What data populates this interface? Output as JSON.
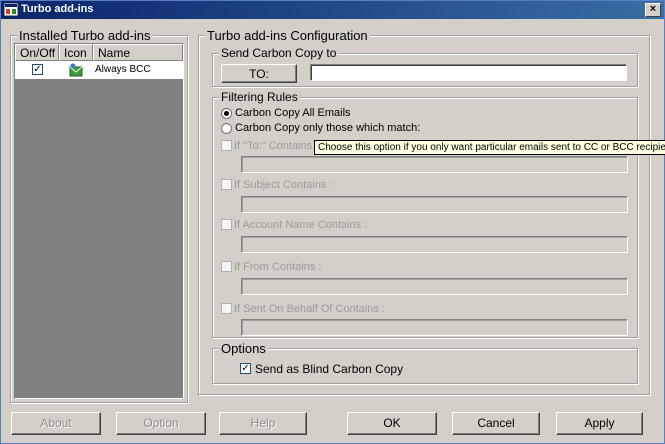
{
  "window": {
    "title": "Turbo add-ins",
    "close_symbol": "×"
  },
  "installed": {
    "group_title": "Installed Turbo add-ins",
    "columns": [
      "On/Off",
      "Icon",
      "Name"
    ],
    "rows": [
      {
        "enabled": "✓",
        "name": "Always BCC"
      }
    ]
  },
  "config": {
    "group_title": "Turbo add-ins Configuration",
    "send_cc": {
      "title": "Send Carbon Copy to",
      "to_button": "TO:",
      "to_value": ""
    },
    "filtering": {
      "title": "Filtering Rules",
      "radio_all": "Carbon Copy All Emails",
      "radio_match": "Carbon Copy only those which match:",
      "rules": [
        {
          "label": "If \"To:\" Contains :",
          "value": ""
        },
        {
          "label": "If Subject Contains :",
          "value": ""
        },
        {
          "label": "If Account Name Contains :",
          "value": ""
        },
        {
          "label": "If From Contains :",
          "value": ""
        },
        {
          "label": "If Sent On Behalf Of Contains :",
          "value": ""
        }
      ],
      "tooltip": "Choose this option if you only want particular emails sent to CC or BCC recipients."
    },
    "options": {
      "title": "Options",
      "bcc_checked": "✓",
      "bcc_label": "Send as Blind Carbon Copy"
    }
  },
  "buttons": {
    "about": "About",
    "option": "Option",
    "help": "Help",
    "ok": "OK",
    "cancel": "Cancel",
    "apply": "Apply"
  }
}
